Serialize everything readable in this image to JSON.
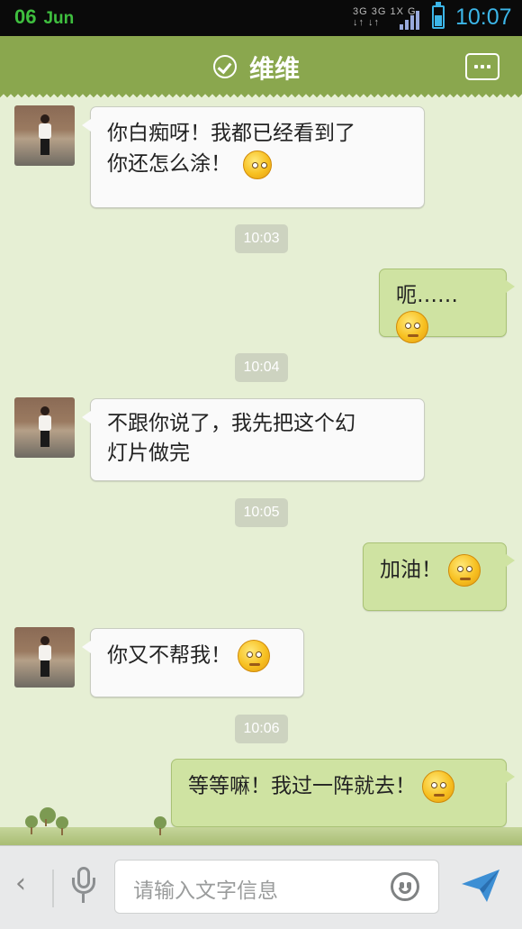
{
  "status_bar": {
    "date_day": "06",
    "date_month": "Jun",
    "network_top": "3G 3G 1X G",
    "network_bottom": "↓↑ ↓↑",
    "time": "10:07"
  },
  "header": {
    "title": "维维",
    "check_icon": "verified-check-icon",
    "menu_icon": "more-menu-icon"
  },
  "messages": [
    {
      "side": "in",
      "lines": [
        "你白痴呀！我都已经看到了",
        "你还怎么涂！"
      ],
      "emoji": "hammer-dazed-emoji"
    },
    {
      "type": "time",
      "text": "10:03"
    },
    {
      "side": "out",
      "text": "呃……",
      "emoji": "awkward-emoji"
    },
    {
      "type": "time",
      "text": "10:04"
    },
    {
      "side": "in",
      "lines": [
        "不跟你说了，我先把这个幻",
        "灯片做完"
      ]
    },
    {
      "type": "time",
      "text": "10:05"
    },
    {
      "side": "out",
      "text": "加油！",
      "emoji": "determined-emoji"
    },
    {
      "side": "in",
      "text": "你又不帮我！",
      "emoji": "crying-emoji"
    },
    {
      "type": "time",
      "text": "10:06"
    },
    {
      "side": "out",
      "text": "等等嘛！我过一阵就去！",
      "emoji": "smug-emoji"
    }
  ],
  "input_bar": {
    "placeholder": "请输入文字信息",
    "back_icon": "chevron-left-icon",
    "mic_icon": "microphone-icon",
    "emoji_icon": "smiley-icon",
    "send_icon": "send-icon"
  },
  "colors": {
    "header": "#8aa74e",
    "background": "#e6efd4",
    "outgoing_bubble": "#cfe3a2",
    "incoming_bubble": "#fafafa",
    "time_blue": "#3cb6e8"
  }
}
